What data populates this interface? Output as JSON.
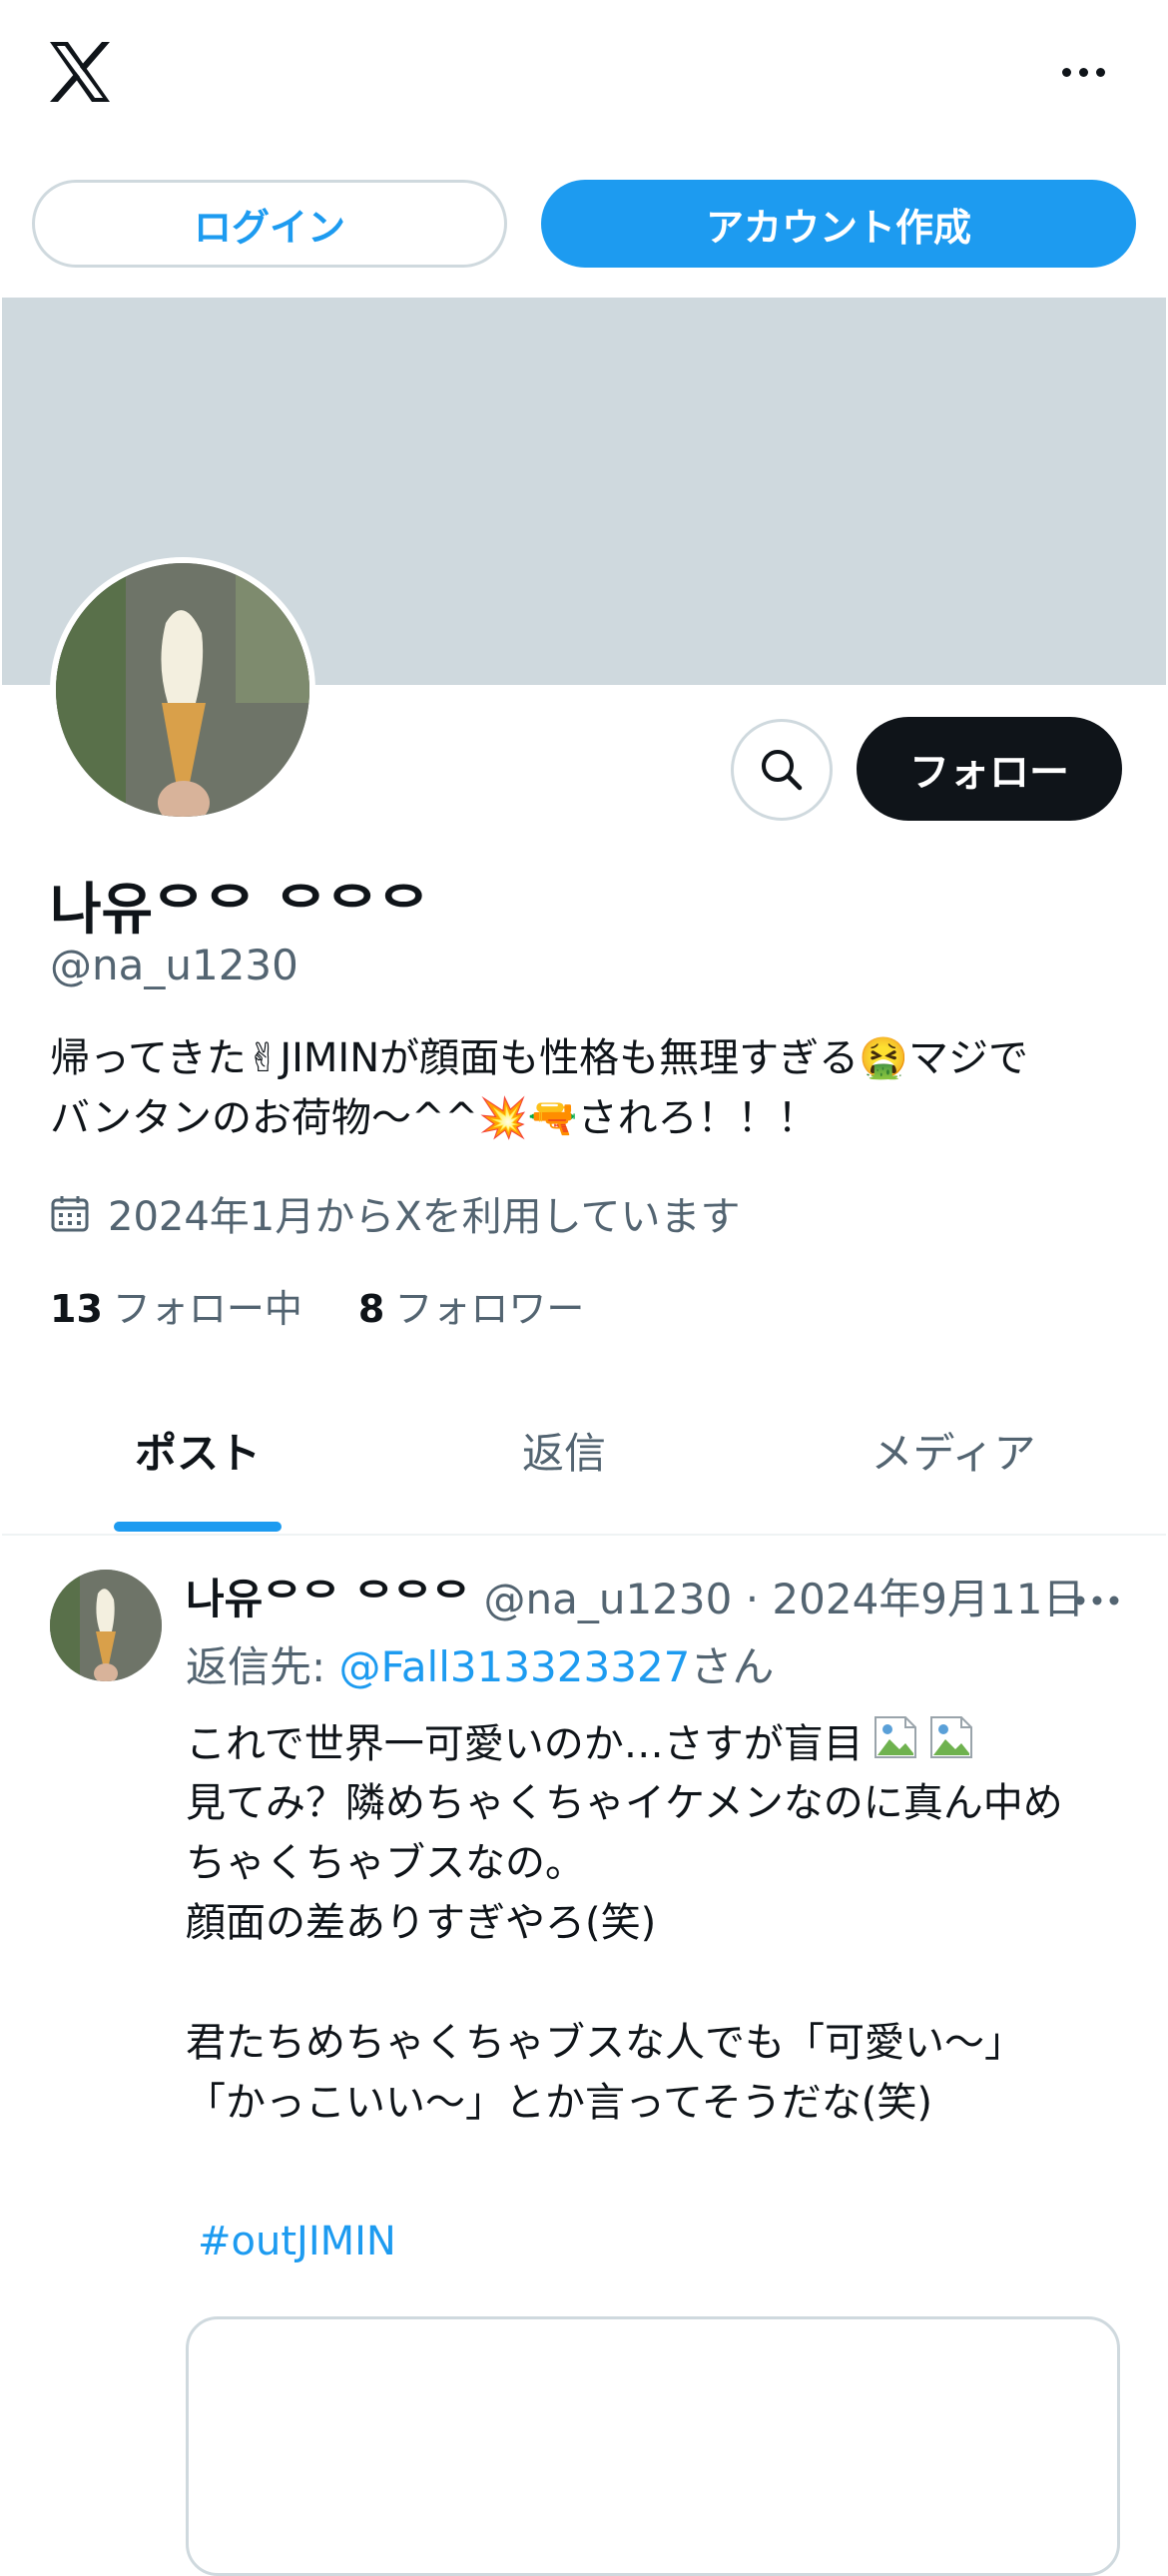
{
  "header": {
    "logo_icon": "x-logo-icon",
    "more_icon": "more-horizontal-icon"
  },
  "auth": {
    "login_label": "ログイン",
    "signup_label": "アカウント作成"
  },
  "colors": {
    "accent": "#1d9bf0",
    "text_primary": "#0f1419",
    "text_secondary": "#536471",
    "banner": "#cfd9de"
  },
  "profile": {
    "display_name": "나유ᄋᄋ ᄋᄋᄋ",
    "handle": "@na_u1230",
    "bio_lines": [
      "帰ってきた✌JIMINが顔面も性格も無理すぎる🤮マジで",
      "バンタンのお荷物〜^^💥🔫されろ！！！"
    ],
    "joined": "2024年1月からXを利用しています",
    "following_count": "13",
    "following_label": "フォロー中",
    "followers_count": "8",
    "followers_label": "フォロワー",
    "follow_button": "フォロー"
  },
  "tabs": [
    {
      "label": "ポスト",
      "selected": true
    },
    {
      "label": "返信",
      "selected": false
    },
    {
      "label": "メディア",
      "selected": false
    }
  ],
  "post": {
    "author_name": "나유ᄋᄋ ᄋᄋᄋ",
    "author_handle": "@na_u1230",
    "separator": "·",
    "date": "2024年9月11日",
    "reply_prefix": "返信先: ",
    "reply_handle": "@Fall313323327",
    "reply_suffix": "さん",
    "body_lines": [
      "これで世界一可愛いのか…さすが盲目",
      "見てみ？隣めちゃくちゃイケメンなのに真ん中め",
      "ちゃくちゃブスなの。",
      "顔面の差ありすぎやろ(笑)",
      "",
      "君たちめちゃくちゃブスな人でも「可愛い〜」",
      "「かっこいい〜」とか言ってそうだな(笑)"
    ],
    "hashtag": "#outJIMIN"
  }
}
